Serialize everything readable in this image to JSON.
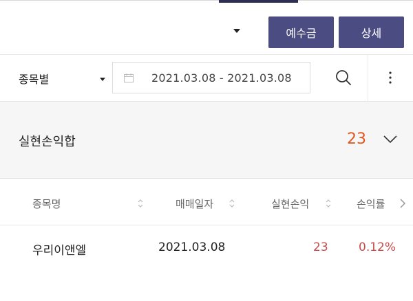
{
  "toolbar": {
    "deposit_label": "예수금",
    "detail_label": "상세"
  },
  "filter": {
    "select_label": "종목별",
    "date_range": "2021.03.08  -  2021.03.08"
  },
  "summary": {
    "label": "실현손익합",
    "value": "23"
  },
  "table": {
    "headers": [
      "종목명",
      "매매일자",
      "실현손익",
      "손익률"
    ],
    "rows": [
      {
        "name": "우리이앤엘",
        "date": "2021.03.08",
        "pnl": "23",
        "rate": "0.12%"
      }
    ]
  },
  "colors": {
    "button_bg": "#4a4c82",
    "summary_value": "#e0571f",
    "profit_red": "#c94a4a"
  },
  "icons": [
    "calendar-icon",
    "search-icon",
    "more-vertical-icon",
    "chevron-down-icon",
    "sort-icon",
    "chevron-right-icon"
  ]
}
